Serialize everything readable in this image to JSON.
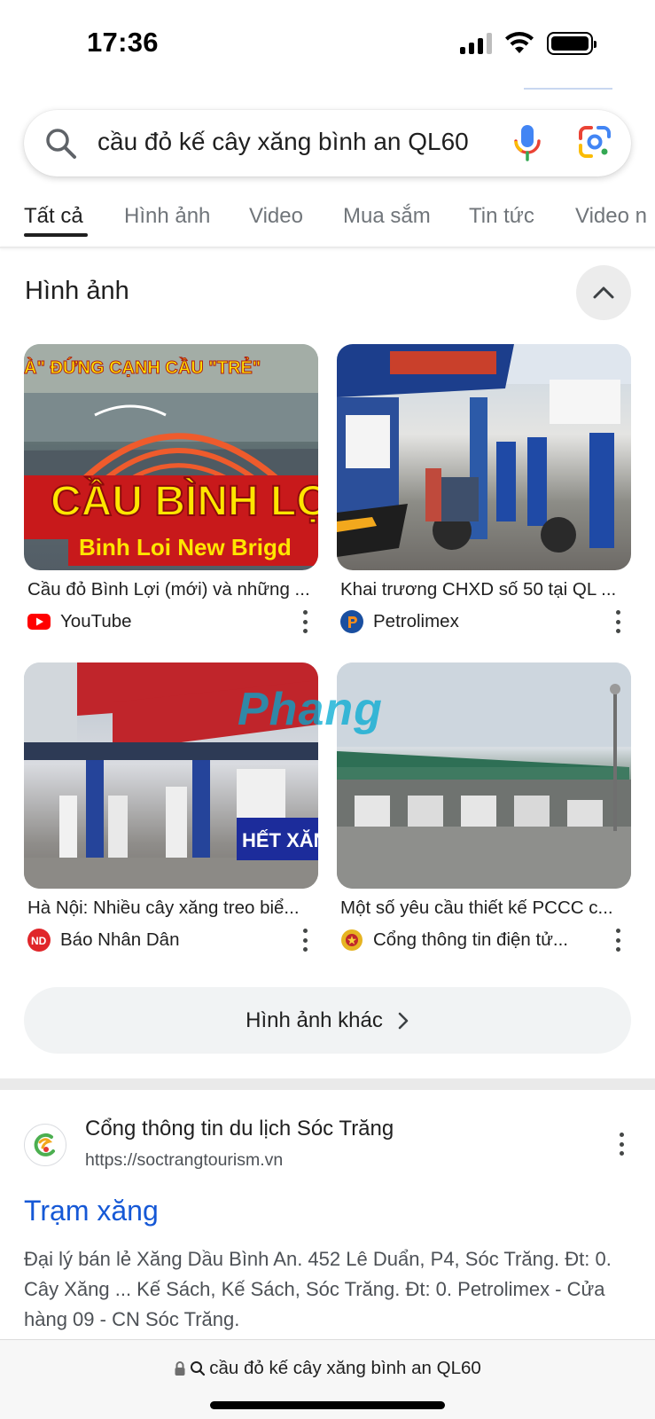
{
  "status_bar": {
    "time": "17:36",
    "battery_level": 1.0,
    "signal_bars": 3
  },
  "search": {
    "query": "cầu đỏ kế cây xăng bình an QL60",
    "icons": [
      "search-icon",
      "mic-icon",
      "lens-icon"
    ]
  },
  "tabs": [
    {
      "label": "Tất cả",
      "active": true
    },
    {
      "label": "Hình ảnh",
      "active": false
    },
    {
      "label": "Video",
      "active": false
    },
    {
      "label": "Mua sắm",
      "active": false
    },
    {
      "label": "Tin tức",
      "active": false
    },
    {
      "label": "Video n",
      "active": false
    }
  ],
  "images_section": {
    "title": "Hình ảnh",
    "items": [
      {
        "caption": "Cầu đỏ Bình Lợi (mới) và những ...",
        "source": "YouTube",
        "overlay_top": "À\" ĐỨNG CẠNH CẦU \"TRẺ\"",
        "overlay_main": "CẦU BÌNH LỢ",
        "overlay_sub": "Binh Loi New Brigd"
      },
      {
        "caption": "Khai trương CHXD số 50 tại QL ...",
        "source": "Petrolimex"
      },
      {
        "caption": "Hà Nội: Nhiều cây xăng treo biể...",
        "source": "Báo Nhân Dân",
        "overlay_sign": "HẾT XĂNG",
        "watermark": "Phang"
      },
      {
        "caption": "Một số yêu cầu thiết kế PCCC c...",
        "source": "Cổng thông tin điện tử..."
      }
    ],
    "more_button": "Hình ảnh khác"
  },
  "result": {
    "site_name": "Cổng thông tin du lịch Sóc Trăng",
    "url": "https://soctrangtourism.vn",
    "title": "Trạm xăng",
    "snippet": "Đại lý bán lẻ Xăng Dầu Bình An. 452 Lê Duẩn, P4, Sóc Trăng. Đt: 0. Cây Xăng ... Kế Sách, Kế Sách, Sóc Trăng. Đt: 0. Petrolimex - Cửa hàng 09 - CN Sóc Trăng."
  },
  "bottom_bar": {
    "url_text": "cầu đỏ kế cây xăng bình an QL60"
  },
  "colors": {
    "link_blue": "#1558d6",
    "text_primary": "#1f1f1f",
    "text_secondary": "#70757a",
    "youtube_red": "#ff0000",
    "petrolimex_blue": "#1a4fa0",
    "petrolimex_orange": "#f28c1e"
  }
}
